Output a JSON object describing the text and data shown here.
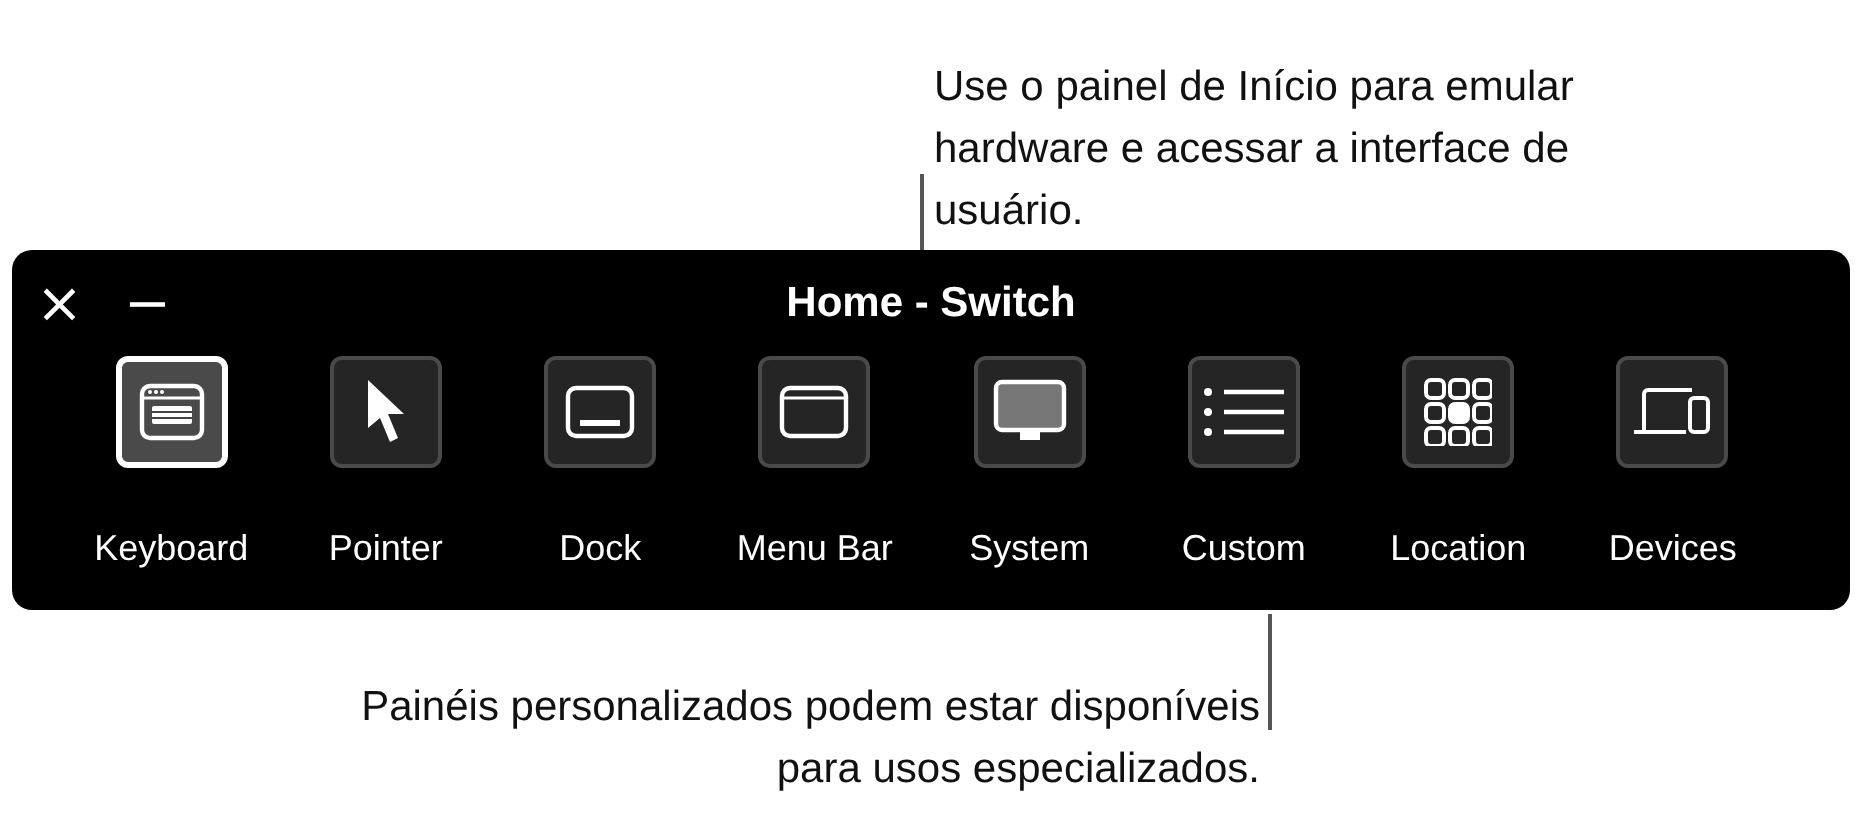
{
  "top_callout": "Use o painel de Início para emular hardware e acessar a interface de usuário.",
  "panel": {
    "title": "Home - Switch",
    "controls": [
      "×",
      "−"
    ],
    "buttons": [
      {
        "label": "Keyboard",
        "kind": "keyboard",
        "selected": true
      },
      {
        "label": "Pointer",
        "kind": "pointer",
        "selected": false
      },
      {
        "label": "Dock",
        "kind": "dock",
        "selected": false
      },
      {
        "label": "Menu Bar",
        "kind": "menubar",
        "selected": false
      },
      {
        "label": "System",
        "kind": "system",
        "selected": false
      },
      {
        "label": "Custom",
        "kind": "custom",
        "selected": false
      },
      {
        "label": "Location",
        "kind": "location",
        "selected": false
      },
      {
        "label": "Devices",
        "kind": "devices",
        "selected": false
      }
    ]
  },
  "bottom_callout": "Painéis personalizados podem estar disponíveis para usos especializados."
}
